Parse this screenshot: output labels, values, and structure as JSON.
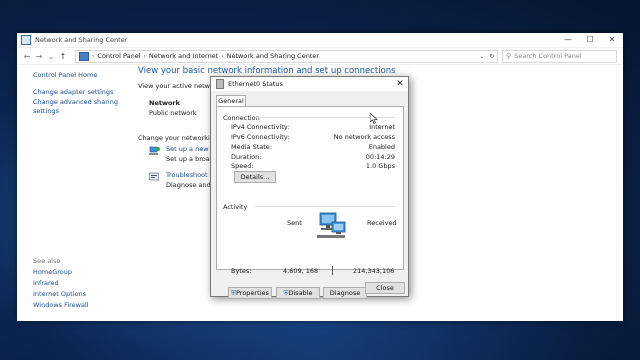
{
  "window": {
    "title": "Network and Sharing Center",
    "controls": [
      "—",
      "☐",
      "✕"
    ]
  },
  "address": {
    "nav": [
      "←",
      "→",
      "⌄",
      "↑"
    ],
    "crumbs": [
      "Control Panel",
      "Network and Internet",
      "Network and Sharing Center"
    ],
    "search_placeholder": "Search Control Panel"
  },
  "sidebar": {
    "home": "Control Panel Home",
    "links": [
      "Change adapter settings",
      "Change advanced sharing settings"
    ],
    "see_also_label": "See also",
    "see_also": [
      "HomeGroup",
      "Infrared",
      "Internet Options",
      "Windows Firewall"
    ]
  },
  "main": {
    "heading": "View your basic network information and set up connections",
    "active_networks_label": "View your active netwo",
    "network_name": "Network",
    "network_type": "Public network",
    "change_settings_label": "Change your networking",
    "tasks": [
      {
        "link": "Set up a new co",
        "desc": "Set up a broadb"
      },
      {
        "link": "Troubleshoot p",
        "desc": "Diagnose and r"
      }
    ]
  },
  "dialog": {
    "title": "Ethernet0 Status",
    "tab": "General",
    "connection_label": "Connection",
    "rows": [
      {
        "label": "IPv4 Connectivity:",
        "value": "Internet"
      },
      {
        "label": "IPv6 Connectivity:",
        "value": "No network access"
      },
      {
        "label": "Media State:",
        "value": "Enabled"
      },
      {
        "label": "Duration:",
        "value": "00:14:29"
      },
      {
        "label": "Speed:",
        "value": "1.0 Gbps"
      }
    ],
    "details_button": "Details...",
    "activity_label": "Activity",
    "sent_label": "Sent",
    "received_label": "Received",
    "bytes_label": "Bytes:",
    "bytes_sent": "4,609, 168",
    "bytes_received": "214,343,106",
    "properties_button": "Properties",
    "disable_button": "Disable",
    "diagnose_button": "Diagnose",
    "close_button": "Close"
  },
  "colors": {
    "link": "#1c4e8e",
    "heading": "#1f58a8",
    "desktop": "#0b2550"
  }
}
